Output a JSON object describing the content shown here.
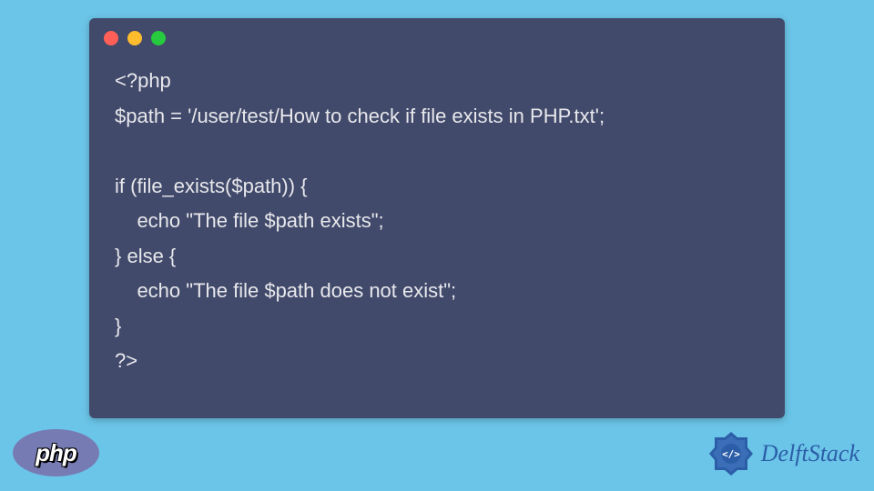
{
  "code": {
    "line1": "<?php",
    "line2": "$path = '/user/test/How to check if file exists in PHP.txt';",
    "line3": "",
    "line4": "if (file_exists($path)) {",
    "line5": "    echo \"The file $path exists\";",
    "line6": "} else {",
    "line7": "    echo \"The file $path does not exist\";",
    "line8": "}",
    "line9": "?>"
  },
  "badges": {
    "php_label": "php",
    "delftstack_label": "DelftStack"
  },
  "colors": {
    "background": "#6bc5e8",
    "window_bg": "#414A6B",
    "text": "#e8e8ec",
    "php_badge": "#777BB3",
    "delftstack_text": "#2c5ea8"
  }
}
